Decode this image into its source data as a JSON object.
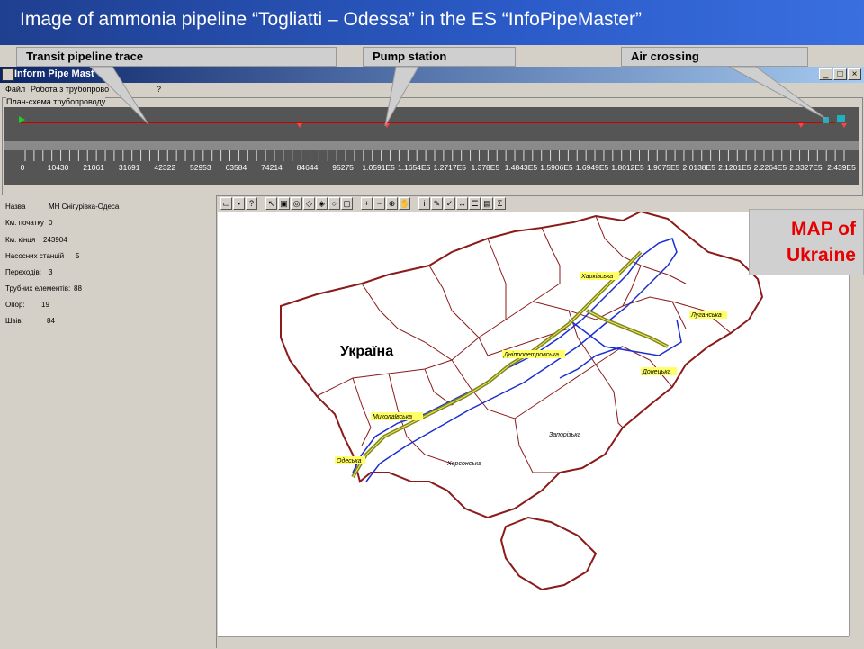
{
  "slide": {
    "title": "Image of ammonia pipeline “Togliatti – Odessa” in the ES “InfoPipeMaster”"
  },
  "callouts": [
    "Transit pipeline trace",
    "Pump station",
    "Air crossing"
  ],
  "window": {
    "title": "Inform Pipe Mast",
    "buttons": [
      "_",
      "□",
      "×"
    ]
  },
  "menu": [
    "Файл",
    "Робота з трубопрово",
    "?"
  ],
  "plan": {
    "label": "План-схема трубопроводу",
    "ruler": [
      "0",
      "10430",
      "21061",
      "31691",
      "42322",
      "52953",
      "63584",
      "74214",
      "84644",
      "95275",
      "1.0591E5",
      "1.1654E5",
      "1.2717E5",
      "1.378E5",
      "1.4843E5",
      "1.5906E5",
      "1.6949E5",
      "1.8012E5",
      "1.9075E5",
      "2.0138E5",
      "2.1201E5",
      "2.2264E5",
      "2.3327E5",
      "2.439E5"
    ]
  },
  "info": {
    "rows": [
      {
        "label": "Назва",
        "value": "МН Снігурівка-Одеса"
      },
      {
        "label": "Км. початку",
        "value": "0"
      },
      {
        "label": "Км. кінця",
        "value": "243904"
      },
      {
        "label": "Насосних станцій :",
        "value": "5"
      },
      {
        "label": "Переходів:",
        "value": "3"
      },
      {
        "label": "Трубних елементів:",
        "value": "88"
      },
      {
        "label": "Опор:",
        "value": "19"
      },
      {
        "label": "Швів:",
        "value": "84"
      }
    ]
  },
  "map": {
    "country_label": "Україна",
    "regions": [
      "Харківська",
      "Луганська",
      "Дніпропетровська",
      "Донецька",
      "Миколаївська",
      "Одеська",
      "Херсонська",
      "Запорізька"
    ]
  },
  "map_of_label": [
    "MAP of",
    "Ukraine"
  ],
  "colors": {
    "pipeline": "#cc0000",
    "trace": "#7a8a1a",
    "route": "#1a2fd0",
    "borders": "#8b1a1a"
  }
}
